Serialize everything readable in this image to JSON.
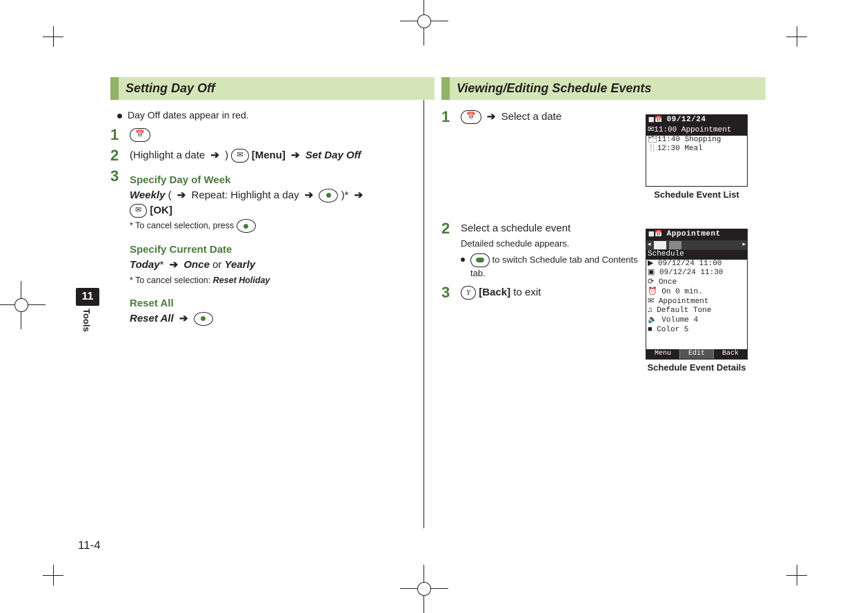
{
  "side": {
    "chapter_num": "11",
    "chapter_label": "Tools"
  },
  "page_number": "11-4",
  "left": {
    "heading": "Setting Day Off",
    "intro": "Day Off dates appear in red.",
    "step2": {
      "text_a": "(Highlight a date ",
      "arrow": "➔",
      "text_b": " ) ",
      "menu": "[Menu]",
      "arrow2": "➔",
      "set_day_off": "Set Day Off"
    },
    "step3": {
      "sub1_title": "Specify Day of Week",
      "weekly": "Weekly",
      "weekly_a": " ( ",
      "arrow": "➔",
      "weekly_b": " Repeat: Highlight a day ",
      "weekly_c": ")* ",
      "ok": "[OK]",
      "note1": "* To cancel selection, press ",
      "sub2_title": "Specify Current Date",
      "today": "Today",
      "star": "* ",
      "once": "Once",
      "or": " or ",
      "yearly": "Yearly",
      "note2_a": "* To cancel selection: ",
      "note2_b": "Reset Holiday",
      "sub3_title": "Reset All",
      "reset_all": "Reset All",
      "reset_arrow": " ➔ "
    }
  },
  "right": {
    "heading": "Viewing/Editing Schedule Events",
    "step1": {
      "arrow": "➔",
      "text": " Select a date"
    },
    "step2": {
      "text": "Select a schedule event",
      "detail": "Detailed schedule appears.",
      "bullet": " to switch Schedule tab and Contents tab."
    },
    "step3": {
      "back": "[Back]",
      "text": " to exit"
    },
    "phone1": {
      "title": "09/12/24",
      "rows": [
        {
          "icon": "✉",
          "time": "11:00",
          "label": "Appointment",
          "hl": true
        },
        {
          "icon": "🗂",
          "time": "11:40",
          "label": "Shopping",
          "hl": false
        },
        {
          "icon": "🍴",
          "time": "12:30",
          "label": "Meal",
          "hl": false
        }
      ],
      "caption": "Schedule Event List"
    },
    "phone2": {
      "title": "Appointment",
      "sub": "Schedule",
      "lines": [
        "▶ 09/12/24 11:00",
        "▣ 09/12/24 11:30",
        "⟳ Once",
        "⏰ On 0 min.",
        "✉ Appointment",
        "♫ Default Tone",
        "🔈 Volume 4",
        "■ Color 5"
      ],
      "soft": [
        "Menu",
        "Edit",
        "Back"
      ],
      "caption": "Schedule Event Details"
    }
  }
}
